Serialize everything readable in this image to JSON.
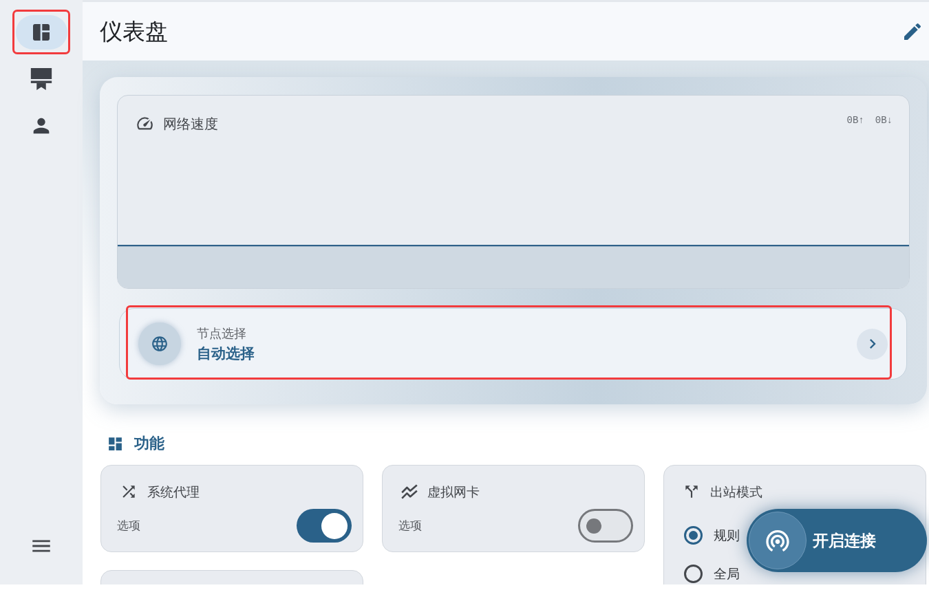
{
  "sidebar": {
    "items": [
      {
        "selected": true,
        "highlighted": true
      },
      {
        "selected": false,
        "highlighted": false
      },
      {
        "selected": false,
        "highlighted": false
      }
    ]
  },
  "header": {
    "title": "仪表盘"
  },
  "speed_card": {
    "title": "网络速度",
    "upload": "0B↑",
    "download": "0B↓"
  },
  "node_card": {
    "label": "节点选择",
    "value": "自动选择",
    "highlighted": true
  },
  "features": {
    "title": "功能",
    "cards": [
      {
        "kind": "switch",
        "title": "系统代理",
        "caption": "选项",
        "on": true
      },
      {
        "kind": "switch",
        "title": "虚拟网卡",
        "caption": "选项",
        "on": false
      },
      {
        "kind": "radio",
        "title": "出站模式",
        "options": [
          {
            "label": "规则",
            "selected": true
          },
          {
            "label": "全局",
            "selected": false
          }
        ]
      },
      {
        "kind": "cut_off"
      }
    ]
  },
  "connect_button": {
    "label": "开启连接"
  }
}
